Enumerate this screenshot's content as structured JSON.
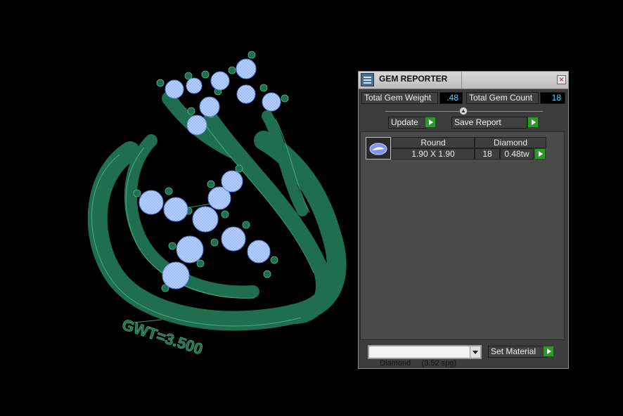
{
  "panel": {
    "title": "GEM REPORTER",
    "close_symbol": "×",
    "total_gem_weight_label": "Total Gem Weight",
    "total_gem_weight_value": ".48",
    "total_gem_count_label": "Total Gem Count",
    "total_gem_count_value": "18",
    "update_label": "Update",
    "save_report_label": "Save Report",
    "collapse_symbol": "▲",
    "table": {
      "columns": [
        "Round",
        "Diamond"
      ],
      "rows": [
        {
          "size": "1.90 X 1.90",
          "count": "18",
          "weight": "0.48tw"
        }
      ]
    },
    "material_selected": "Diamond     (3.52 spg)",
    "set_material_label": "Set Material"
  },
  "viewport": {
    "engraving_text": "GWT=3.500",
    "ring_color": "#1f6e4f",
    "gem_color": "#8fb3ff"
  }
}
